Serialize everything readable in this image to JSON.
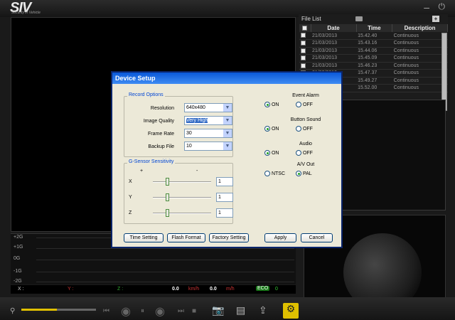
{
  "app": {
    "logo": "SIV",
    "tagline": "Security in Vehicle"
  },
  "file_list": {
    "title": "File List",
    "columns": [
      "Date",
      "Time",
      "Description"
    ],
    "rows": [
      {
        "date": "21/03/2013",
        "time": "15.42.40",
        "desc": "Continuous"
      },
      {
        "date": "21/03/2013",
        "time": "15.43.16",
        "desc": "Continuous"
      },
      {
        "date": "21/03/2013",
        "time": "15.44.06",
        "desc": "Continuous"
      },
      {
        "date": "21/03/2013",
        "time": "15.45.09",
        "desc": "Continuous"
      },
      {
        "date": "21/03/2013",
        "time": "15.46.23",
        "desc": "Continuous"
      },
      {
        "date": "21/03/2013",
        "time": "15.47.37",
        "desc": "Continuous"
      },
      {
        "date": "21/03/2013",
        "time": "15.49.27",
        "desc": "Continuous"
      },
      {
        "date": "21/03/2013",
        "time": "15.52.00",
        "desc": "Continuous"
      }
    ]
  },
  "graph": {
    "labels": [
      "+2G",
      "+1G",
      "0G",
      "-1G",
      "-2G"
    ]
  },
  "readout": {
    "x": "X :",
    "y": "Y :",
    "z": "Z :",
    "speed": "0.0",
    "speed_unit": "km/h",
    "dist": "0.0",
    "dist_unit": "m/h",
    "eco": "ECO",
    "eco_val": "0"
  },
  "dialog": {
    "title": "Device Setup",
    "record_options": {
      "title": "Record Options",
      "resolution": {
        "label": "Resolution",
        "value": "640x480"
      },
      "image_quality": {
        "label": "Image Quality",
        "value": "Very High"
      },
      "frame_rate": {
        "label": "Frame Rate",
        "value": "30"
      },
      "backup_file": {
        "label": "Backup File",
        "value": "10"
      }
    },
    "gsensor": {
      "title": "G-Sensor Sensitivity",
      "plus": "+",
      "minus": "-",
      "axes": [
        {
          "label": "X",
          "value": "1",
          "level": 0.25
        },
        {
          "label": "Y",
          "value": "1",
          "level": 0.25
        },
        {
          "label": "Z",
          "value": "1",
          "level": 0.25
        }
      ]
    },
    "event_alarm": {
      "title": "Event Alarm",
      "on": "ON",
      "off": "OFF",
      "selected": "ON"
    },
    "button_sound": {
      "title": "Button Sound",
      "on": "ON",
      "off": "OFF",
      "selected": "ON"
    },
    "audio": {
      "title": "Audio",
      "on": "ON",
      "off": "OFF",
      "selected": "ON"
    },
    "av_out": {
      "title": "A/V Out",
      "ntsc": "NTSC",
      "pal": "PAL",
      "selected": "PAL"
    },
    "buttons": {
      "time_setting": "Time Setting",
      "flash_format": "Flash Format",
      "factory_setting": "Factory Setting",
      "apply": "Apply",
      "cancel": "Cancel"
    }
  }
}
